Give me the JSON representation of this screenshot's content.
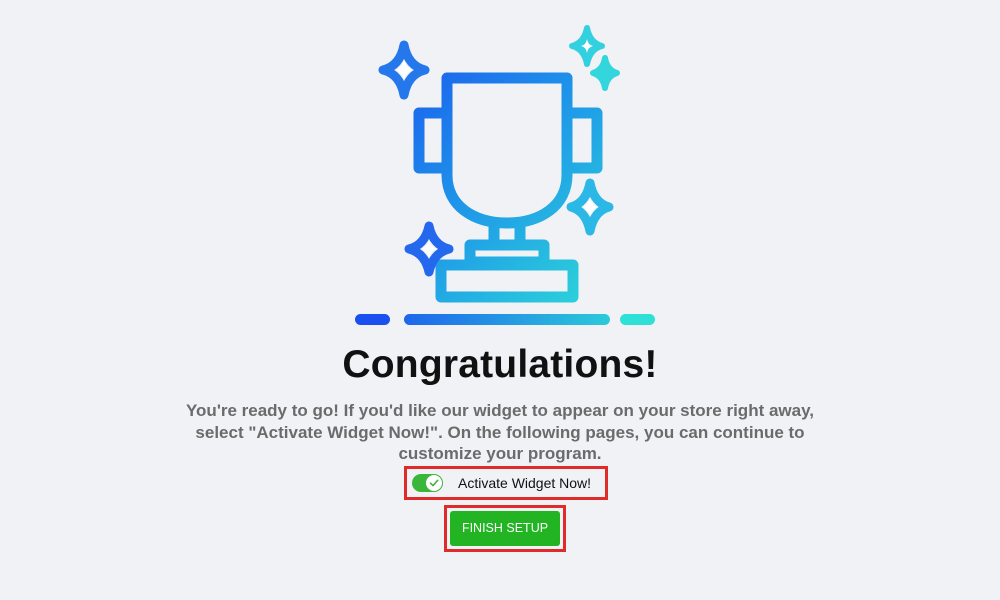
{
  "hero": {
    "icon": "trophy-icon",
    "sparkles": [
      "sparkle-icon",
      "sparkle-icon",
      "sparkle-icon",
      "sparkle-icon",
      "sparkle-icon"
    ],
    "gradient_colors": [
      "#1a5cf0",
      "#2fe0d6"
    ]
  },
  "title": "Congratulations!",
  "message": "You're ready to go! If you'd like our widget to appear on your store right away, select \"Activate Widget Now!\". On the following pages, you can continue to customize your program.",
  "activate_toggle": {
    "label": "Activate Widget Now!",
    "checked": true,
    "icon": "check-icon",
    "color": "#3ab63a"
  },
  "finish_button": {
    "label": "FINISH SETUP",
    "color": "#22b422"
  },
  "highlight_color": "#e02b2b"
}
